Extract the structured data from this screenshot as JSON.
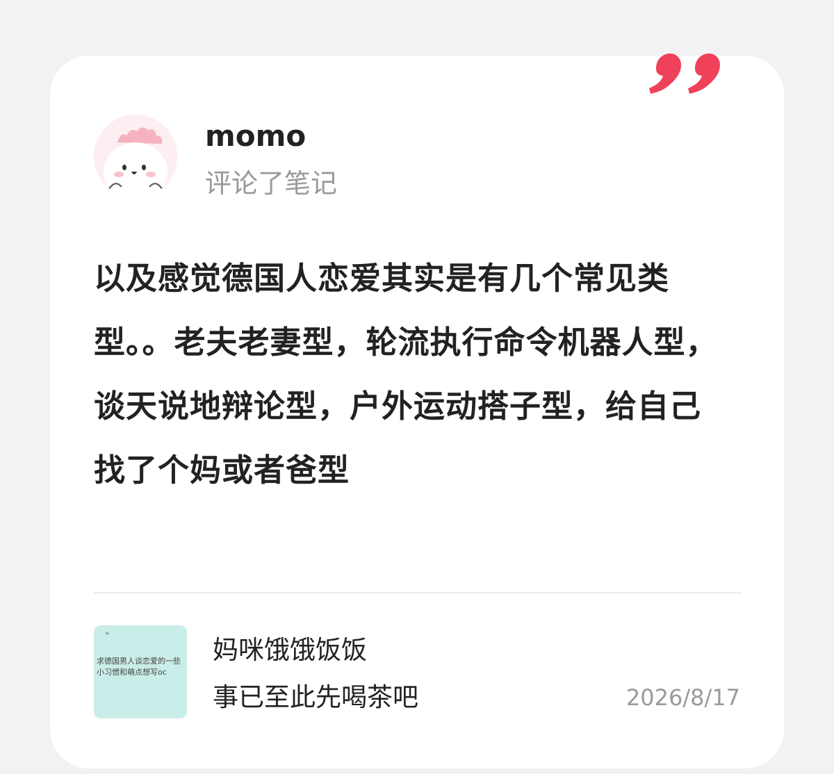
{
  "user": {
    "name": "momo",
    "action": "评论了笔记"
  },
  "comment": {
    "text": "以及感觉德国人恋爱其实是有几个常见类型。。老夫老妻型，轮流执行命令机器人型，谈天说地辩论型，户外运动搭子型，给自己找了个妈或者爸型"
  },
  "note": {
    "thumbnail_text": "求德国男人谈恋爱的一些小习惯和萌点想写oc",
    "author": "妈咪饿饿饭饭",
    "title": "事已至此先喝茶吧",
    "date": "2026/8/17"
  },
  "icons": {
    "quote": "quote-mark-icon",
    "avatar": "pink-dino-avatar"
  },
  "colors": {
    "accent": "#f0415b",
    "thumbnail_bg": "#c9ede8",
    "avatar_bg": "#fdeef1"
  }
}
